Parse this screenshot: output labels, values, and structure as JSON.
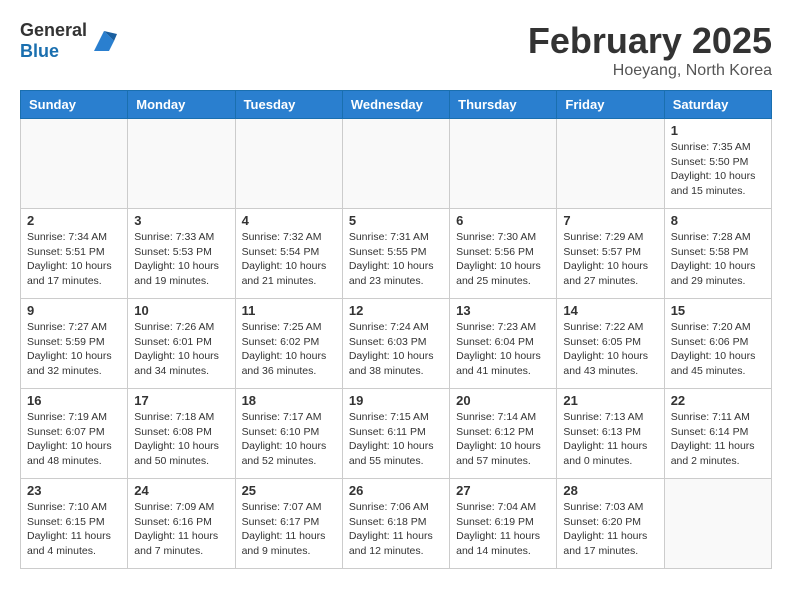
{
  "header": {
    "logo_general": "General",
    "logo_blue": "Blue",
    "month": "February 2025",
    "location": "Hoeyang, North Korea"
  },
  "weekdays": [
    "Sunday",
    "Monday",
    "Tuesday",
    "Wednesday",
    "Thursday",
    "Friday",
    "Saturday"
  ],
  "weeks": [
    [
      {
        "day": "",
        "info": ""
      },
      {
        "day": "",
        "info": ""
      },
      {
        "day": "",
        "info": ""
      },
      {
        "day": "",
        "info": ""
      },
      {
        "day": "",
        "info": ""
      },
      {
        "day": "",
        "info": ""
      },
      {
        "day": "1",
        "info": "Sunrise: 7:35 AM\nSunset: 5:50 PM\nDaylight: 10 hours\nand 15 minutes."
      }
    ],
    [
      {
        "day": "2",
        "info": "Sunrise: 7:34 AM\nSunset: 5:51 PM\nDaylight: 10 hours\nand 17 minutes."
      },
      {
        "day": "3",
        "info": "Sunrise: 7:33 AM\nSunset: 5:53 PM\nDaylight: 10 hours\nand 19 minutes."
      },
      {
        "day": "4",
        "info": "Sunrise: 7:32 AM\nSunset: 5:54 PM\nDaylight: 10 hours\nand 21 minutes."
      },
      {
        "day": "5",
        "info": "Sunrise: 7:31 AM\nSunset: 5:55 PM\nDaylight: 10 hours\nand 23 minutes."
      },
      {
        "day": "6",
        "info": "Sunrise: 7:30 AM\nSunset: 5:56 PM\nDaylight: 10 hours\nand 25 minutes."
      },
      {
        "day": "7",
        "info": "Sunrise: 7:29 AM\nSunset: 5:57 PM\nDaylight: 10 hours\nand 27 minutes."
      },
      {
        "day": "8",
        "info": "Sunrise: 7:28 AM\nSunset: 5:58 PM\nDaylight: 10 hours\nand 29 minutes."
      }
    ],
    [
      {
        "day": "9",
        "info": "Sunrise: 7:27 AM\nSunset: 5:59 PM\nDaylight: 10 hours\nand 32 minutes."
      },
      {
        "day": "10",
        "info": "Sunrise: 7:26 AM\nSunset: 6:01 PM\nDaylight: 10 hours\nand 34 minutes."
      },
      {
        "day": "11",
        "info": "Sunrise: 7:25 AM\nSunset: 6:02 PM\nDaylight: 10 hours\nand 36 minutes."
      },
      {
        "day": "12",
        "info": "Sunrise: 7:24 AM\nSunset: 6:03 PM\nDaylight: 10 hours\nand 38 minutes."
      },
      {
        "day": "13",
        "info": "Sunrise: 7:23 AM\nSunset: 6:04 PM\nDaylight: 10 hours\nand 41 minutes."
      },
      {
        "day": "14",
        "info": "Sunrise: 7:22 AM\nSunset: 6:05 PM\nDaylight: 10 hours\nand 43 minutes."
      },
      {
        "day": "15",
        "info": "Sunrise: 7:20 AM\nSunset: 6:06 PM\nDaylight: 10 hours\nand 45 minutes."
      }
    ],
    [
      {
        "day": "16",
        "info": "Sunrise: 7:19 AM\nSunset: 6:07 PM\nDaylight: 10 hours\nand 48 minutes."
      },
      {
        "day": "17",
        "info": "Sunrise: 7:18 AM\nSunset: 6:08 PM\nDaylight: 10 hours\nand 50 minutes."
      },
      {
        "day": "18",
        "info": "Sunrise: 7:17 AM\nSunset: 6:10 PM\nDaylight: 10 hours\nand 52 minutes."
      },
      {
        "day": "19",
        "info": "Sunrise: 7:15 AM\nSunset: 6:11 PM\nDaylight: 10 hours\nand 55 minutes."
      },
      {
        "day": "20",
        "info": "Sunrise: 7:14 AM\nSunset: 6:12 PM\nDaylight: 10 hours\nand 57 minutes."
      },
      {
        "day": "21",
        "info": "Sunrise: 7:13 AM\nSunset: 6:13 PM\nDaylight: 11 hours\nand 0 minutes."
      },
      {
        "day": "22",
        "info": "Sunrise: 7:11 AM\nSunset: 6:14 PM\nDaylight: 11 hours\nand 2 minutes."
      }
    ],
    [
      {
        "day": "23",
        "info": "Sunrise: 7:10 AM\nSunset: 6:15 PM\nDaylight: 11 hours\nand 4 minutes."
      },
      {
        "day": "24",
        "info": "Sunrise: 7:09 AM\nSunset: 6:16 PM\nDaylight: 11 hours\nand 7 minutes."
      },
      {
        "day": "25",
        "info": "Sunrise: 7:07 AM\nSunset: 6:17 PM\nDaylight: 11 hours\nand 9 minutes."
      },
      {
        "day": "26",
        "info": "Sunrise: 7:06 AM\nSunset: 6:18 PM\nDaylight: 11 hours\nand 12 minutes."
      },
      {
        "day": "27",
        "info": "Sunrise: 7:04 AM\nSunset: 6:19 PM\nDaylight: 11 hours\nand 14 minutes."
      },
      {
        "day": "28",
        "info": "Sunrise: 7:03 AM\nSunset: 6:20 PM\nDaylight: 11 hours\nand 17 minutes."
      },
      {
        "day": "",
        "info": ""
      }
    ]
  ]
}
